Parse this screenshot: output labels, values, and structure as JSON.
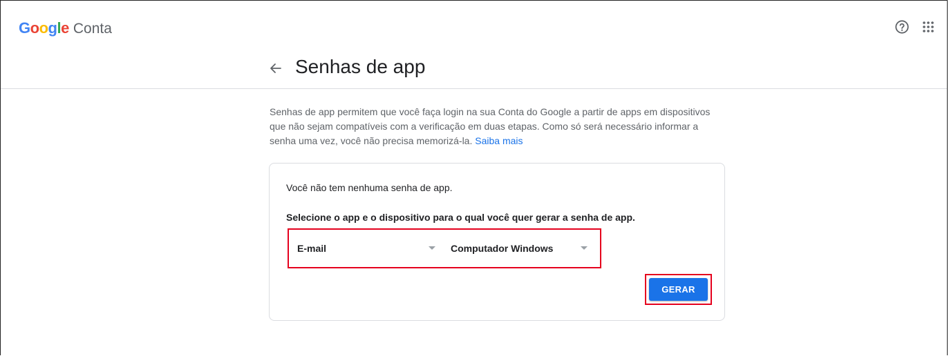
{
  "header": {
    "logo_letters": [
      {
        "char": "G",
        "color": "#4285F4"
      },
      {
        "char": "o",
        "color": "#EA4335"
      },
      {
        "char": "o",
        "color": "#FBBC05"
      },
      {
        "char": "g",
        "color": "#4285F4"
      },
      {
        "char": "l",
        "color": "#34A853"
      },
      {
        "char": "e",
        "color": "#EA4335"
      }
    ],
    "product": "Conta",
    "help_icon": "help-circle-icon",
    "apps_icon": "apps-grid-icon"
  },
  "page": {
    "back_icon": "arrow-back-icon",
    "title": "Senhas de app"
  },
  "intro": {
    "text": "Senhas de app permitem que você faça login na sua Conta do Google a partir de apps em dispositivos que não sejam compatíveis com a verificação em duas etapas. Como só será necessário informar a senha uma vez, você não precisa memorizá-la.",
    "link": "Saiba mais"
  },
  "card": {
    "empty_message": "Você não tem nenhuma senha de app.",
    "instruction": "Selecione o app e o dispositivo para o qual você quer gerar a senha de app.",
    "app_select": "E-mail",
    "device_select": "Computador Windows",
    "generate_button": "GERAR"
  },
  "colors": {
    "accent": "#1a73e8",
    "highlight": "#e5001d"
  }
}
